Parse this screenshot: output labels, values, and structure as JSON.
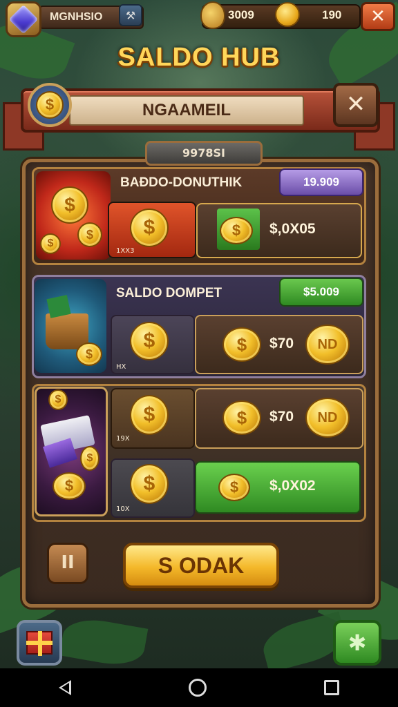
{
  "topbar": {
    "player_name": "MGNHSIO",
    "gold_value": "3009",
    "coin_value": "190",
    "close_label": "✕"
  },
  "title": "SALDO HUB",
  "ribbon": {
    "label": "NGAAMEIL",
    "close_label": "✕"
  },
  "sub_tab": "9978SI",
  "rows": [
    {
      "title": "BAĐDO-DONUTHIK",
      "price": "19.909",
      "amount": "$,0X05",
      "tiny": "1XX3"
    },
    {
      "title": "SALDO DOMPET",
      "price": "$5.009",
      "amount": "$70",
      "tiny": "HX",
      "badge": "ND"
    },
    {
      "title": "",
      "amount": "$70",
      "tiny": "19X",
      "badge": "ND"
    },
    {
      "title": "",
      "amount": "$,0X02",
      "tiny": "10X"
    }
  ],
  "buttons": {
    "pause": "II",
    "main": "S ODAK"
  },
  "icons": {
    "coin": "$",
    "gem": "gem-icon",
    "gift": "gift-icon",
    "puzzle": "puzzle-icon"
  },
  "colors": {
    "gold": "#ffd65a",
    "ribbon": "#b7523a",
    "green_pill": "#3f9a36",
    "purple_pill": "#8a6bc7"
  }
}
